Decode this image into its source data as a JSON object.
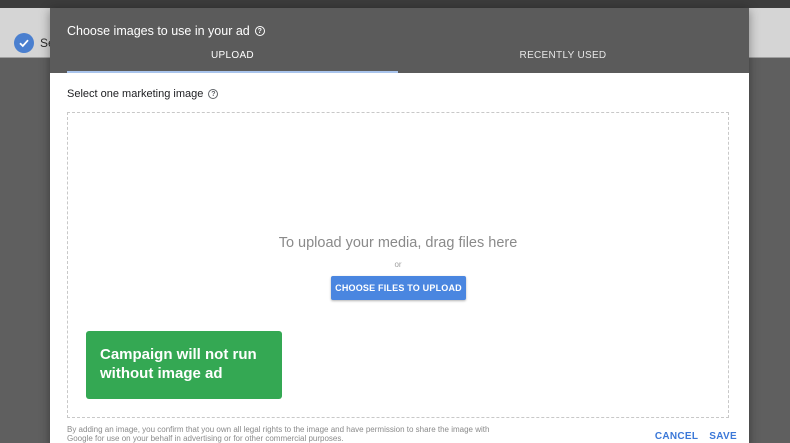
{
  "backdrop": {
    "topbar_items": [
      "",
      "",
      ""
    ],
    "step_label": "Se"
  },
  "dialog": {
    "title": "Choose images to use in your ad",
    "tabs": [
      {
        "label": "UPLOAD",
        "active": true
      },
      {
        "label": "RECENTLY USED",
        "active": false
      }
    ],
    "select_label": "Select one marketing image",
    "dropzone": {
      "title": "To upload your media, drag files here",
      "or": "or",
      "button": "CHOOSE FILES TO UPLOAD"
    },
    "legal_text": "By adding an image, you confirm that you own all legal rights to the image and have permission to share the image with Google for use on your behalf in advertising or for other commercial purposes.",
    "actions": {
      "cancel": "CANCEL",
      "save": "SAVE"
    }
  },
  "toast": {
    "line1": "Campaign will not run",
    "line2": "without image ad"
  },
  "colors": {
    "accent": "#4a86e0",
    "toast": "#34a853",
    "header": "#5b5b5b"
  }
}
